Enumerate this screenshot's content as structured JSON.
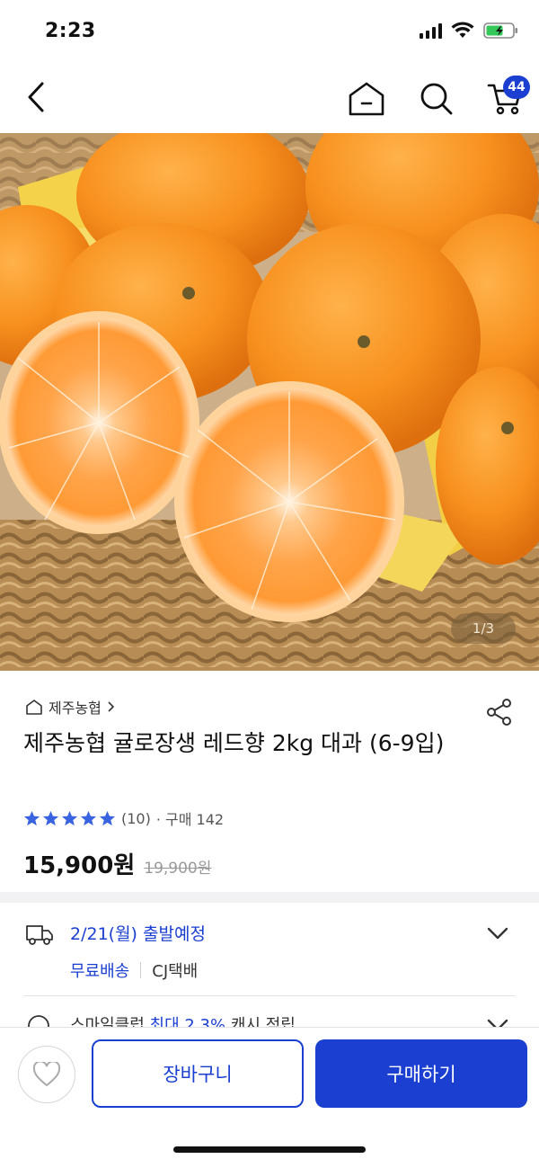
{
  "status_bar": {
    "time": "2:23"
  },
  "nav": {
    "cart_count": "44"
  },
  "product": {
    "image_counter": "1/3",
    "brand": "제주농협",
    "title": "제주농협 귤로장생 레드향 2kg 대과 (6-9입)",
    "rating_count": "(10)",
    "purchases": "· 구매 142",
    "price": "15,900원",
    "original_price": "19,900원",
    "rating_stars": 5
  },
  "delivery": {
    "date": "2/21(월) 출발예정",
    "free_shipping": "무료배송",
    "carrier": "CJ택배"
  },
  "cashback": {
    "prefix": "스마일클럽",
    "highlight": "최대 2.3%",
    "suffix": "캐시 적립"
  },
  "bottom_bar": {
    "cart_label": "장바구니",
    "buy_label": "구매하기"
  },
  "colors": {
    "accent": "#1b3fd1",
    "star": "#3a63e0"
  }
}
